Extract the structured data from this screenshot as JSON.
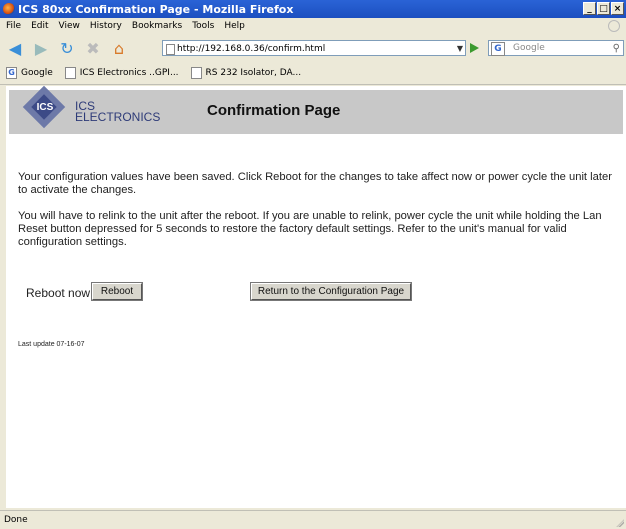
{
  "window": {
    "title": "ICS 80xx Confirmation Page - Mozilla Firefox",
    "controls": [
      "_",
      "□",
      "×"
    ]
  },
  "menu": [
    "File",
    "Edit",
    "View",
    "History",
    "Bookmarks",
    "Tools",
    "Help"
  ],
  "toolbar": {
    "back_icon": "back-arrow-icon",
    "forward_icon": "forward-arrow-icon",
    "reload_icon": "reload-icon",
    "stop_icon": "stop-icon",
    "home_icon": "home-icon",
    "url": "http://192.168.0.36/confirm.html",
    "search_placeholder": "Google",
    "search_engine_letter": "G"
  },
  "bookmarks": [
    {
      "label": "Google",
      "icon": "G"
    },
    {
      "label": "ICS Electronics ..GPI...",
      "icon": ""
    },
    {
      "label": "RS 232 Isolator, DA...",
      "icon": ""
    }
  ],
  "page": {
    "logo_abbrev": "ICS",
    "logo_line1": "ICS",
    "logo_line2": "ELECTRONICS",
    "heading": "Confirmation Page",
    "paragraph1": "Your configuration values have been saved. Click Reboot for the changes to take affect now or power cycle the unit later to activate the changes.",
    "paragraph2": "You will have to relink to the unit after the reboot. If you are unable to relink, power cycle the unit while holding the Lan Reset button depressed for 5 seconds to restore the factory default settings. Refer to the unit's manual for valid configuration settings.",
    "reboot_label": "Reboot now",
    "reboot_button": "Reboot",
    "return_button": "Return to the Configuration Page",
    "last_update": "Last update 07-16-07"
  },
  "status": {
    "text": "Done"
  }
}
